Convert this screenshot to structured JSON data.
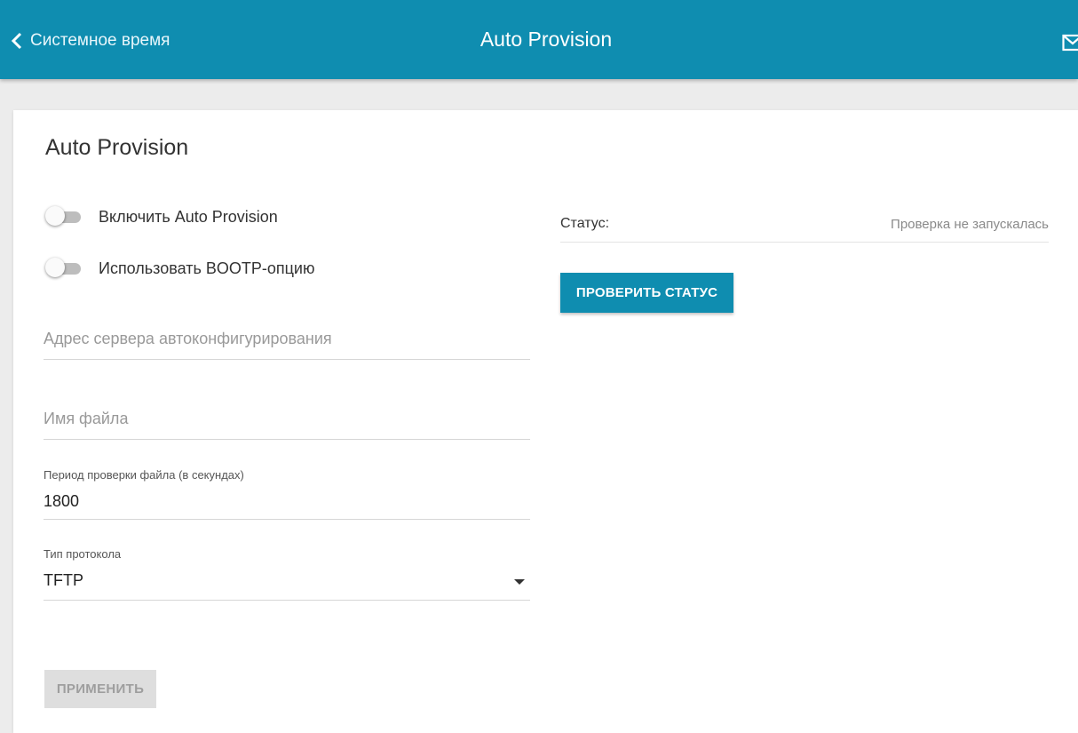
{
  "header": {
    "back_label": "Системное время",
    "title": "Auto Provision",
    "accent_color": "#0f8db0"
  },
  "card": {
    "title": "Auto Provision"
  },
  "switches": {
    "enable_label": "Включить Auto Provision",
    "enable_on": false,
    "bootp_label": "Использовать BOOTP-опцию",
    "bootp_on": false
  },
  "fields": {
    "server_placeholder": "Адрес сервера автоконфигурирования",
    "server_value": "",
    "filename_placeholder": "Имя файла",
    "filename_value": "",
    "period_label": "Период проверки файла (в секундах)",
    "period_value": "1800",
    "protocol_label": "Тип протокола",
    "protocol_value": "TFTP"
  },
  "status": {
    "label": "Статус:",
    "value": "Проверка не запускалась"
  },
  "buttons": {
    "check_status": "ПРОВЕРИТЬ СТАТУС",
    "apply": "ПРИМЕНИТЬ"
  },
  "icons": {
    "back": "chevron-left-icon",
    "mail": "mail-icon",
    "dropdown": "caret-down-icon"
  }
}
